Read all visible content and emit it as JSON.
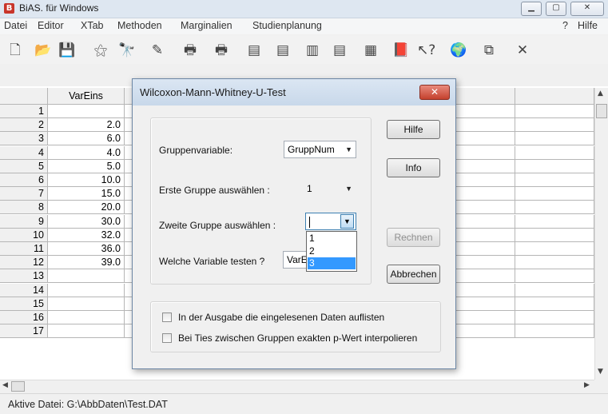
{
  "window": {
    "title": "BiAS. für Windows",
    "app_icon": "b-logo-icon",
    "controls": [
      "minimize-icon",
      "maximize-icon",
      "close-icon"
    ]
  },
  "menu": [
    "Datei",
    "Editor",
    "XTab",
    "Methoden",
    "Marginalien",
    "Studienplanung",
    "?",
    "Hilfe"
  ],
  "toolbar": [
    "new-file-icon",
    "open-folder-icon",
    "save-disk-icon",
    "magic-wand-icon",
    "binoculars-icon",
    "edit-icon",
    "printer-icon",
    "printer-gray-icon",
    "doc-chart-icon",
    "doc-chart2-icon",
    "doc-bar-icon",
    "doc-chart3-icon",
    "calculator-icon",
    "book-icon",
    "help-pointer-icon",
    "globe-icon",
    "copy-icon",
    "close-x-icon"
  ],
  "toolbar_glyphs": [
    "🗋",
    "📂",
    "💾",
    "⚝",
    "🔭",
    "✎",
    "🖶",
    "🖶",
    "▤",
    "▤",
    "▥",
    "▤",
    "▦",
    "📕",
    "↖?",
    "🌍",
    "⧉",
    "✕"
  ],
  "grid": {
    "column_header": "VarEins",
    "rows": [
      {
        "n": "1",
        "v": ""
      },
      {
        "n": "2",
        "v": "2.0"
      },
      {
        "n": "3",
        "v": "6.0"
      },
      {
        "n": "4",
        "v": "4.0"
      },
      {
        "n": "5",
        "v": "5.0"
      },
      {
        "n": "6",
        "v": "10.0"
      },
      {
        "n": "7",
        "v": "15.0"
      },
      {
        "n": "8",
        "v": "20.0"
      },
      {
        "n": "9",
        "v": "30.0"
      },
      {
        "n": "10",
        "v": "32.0"
      },
      {
        "n": "11",
        "v": "36.0"
      },
      {
        "n": "12",
        "v": "39.0"
      },
      {
        "n": "13",
        "v": ""
      },
      {
        "n": "14",
        "v": ""
      },
      {
        "n": "15",
        "v": ""
      },
      {
        "n": "16",
        "v": ""
      },
      {
        "n": "17",
        "v": ""
      }
    ]
  },
  "status": "Aktive Datei: G:\\AbbDaten\\Test.DAT",
  "dialog": {
    "title": "Wilcoxon-Mann-Whitney-U-Test",
    "group_var_label": "Gruppenvariable:",
    "group_var_value": "GruppNum",
    "first_group_label": "Erste Gruppe auswählen :",
    "first_group_value": "1",
    "second_group_label": "Zweite Gruppe auswählen :",
    "second_group_value": "",
    "second_group_options": [
      "1",
      "2",
      "3"
    ],
    "second_group_highlight": "3",
    "test_var_label": "Welche Variable testen ?",
    "test_var_value": "VarE",
    "buttons": {
      "help": "Hilfe",
      "info": "Info",
      "compute": "Rechnen",
      "cancel": "Abbrechen"
    },
    "check_list_data": "In der Ausgabe die eingelesenen Daten auflisten",
    "check_ties": "Bei Ties zwischen Gruppen exakten p-Wert interpolieren"
  }
}
